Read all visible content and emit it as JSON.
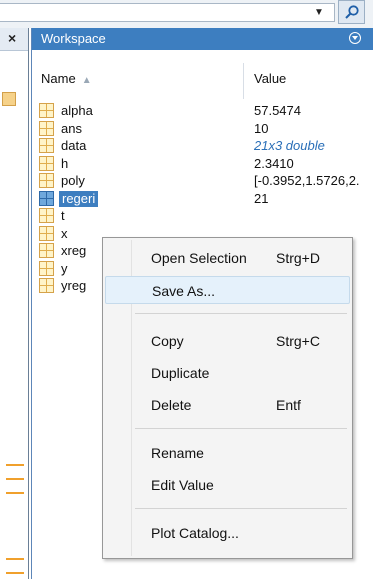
{
  "toolbar": {
    "dropdown_glyph": "▼",
    "search_icon": "magnifier-icon"
  },
  "left_panel": {
    "close_glyph": "×"
  },
  "workspace": {
    "title": "Workspace",
    "menu_icon": "circle-chevron-down-icon",
    "columns": {
      "name": "Name",
      "sort_glyph": "▲",
      "value": "Value"
    },
    "variables": [
      {
        "name": "alpha",
        "value": "57.5474"
      },
      {
        "name": "ans",
        "value": "10"
      },
      {
        "name": "data",
        "value": "21x3 double"
      },
      {
        "name": "h",
        "value": "2.3410"
      },
      {
        "name": "poly",
        "value": "[-0.3952,1.5726,2."
      },
      {
        "name": "regeri",
        "value": "21"
      },
      {
        "name": "t",
        "value": ""
      },
      {
        "name": "x",
        "value": ""
      },
      {
        "name": "xreg",
        "value": ""
      },
      {
        "name": "y",
        "value": ""
      },
      {
        "name": "yreg",
        "value": ""
      }
    ]
  },
  "context_menu": {
    "items": [
      {
        "label": "Open Selection",
        "shortcut": "Strg+D"
      },
      {
        "label": "Save As...",
        "shortcut": ""
      },
      {
        "label": "Copy",
        "shortcut": "Strg+C"
      },
      {
        "label": "Duplicate",
        "shortcut": ""
      },
      {
        "label": "Delete",
        "shortcut": "Entf"
      },
      {
        "label": "Rename",
        "shortcut": ""
      },
      {
        "label": "Edit Value",
        "shortcut": ""
      },
      {
        "label": "Plot Catalog...",
        "shortcut": ""
      }
    ]
  }
}
